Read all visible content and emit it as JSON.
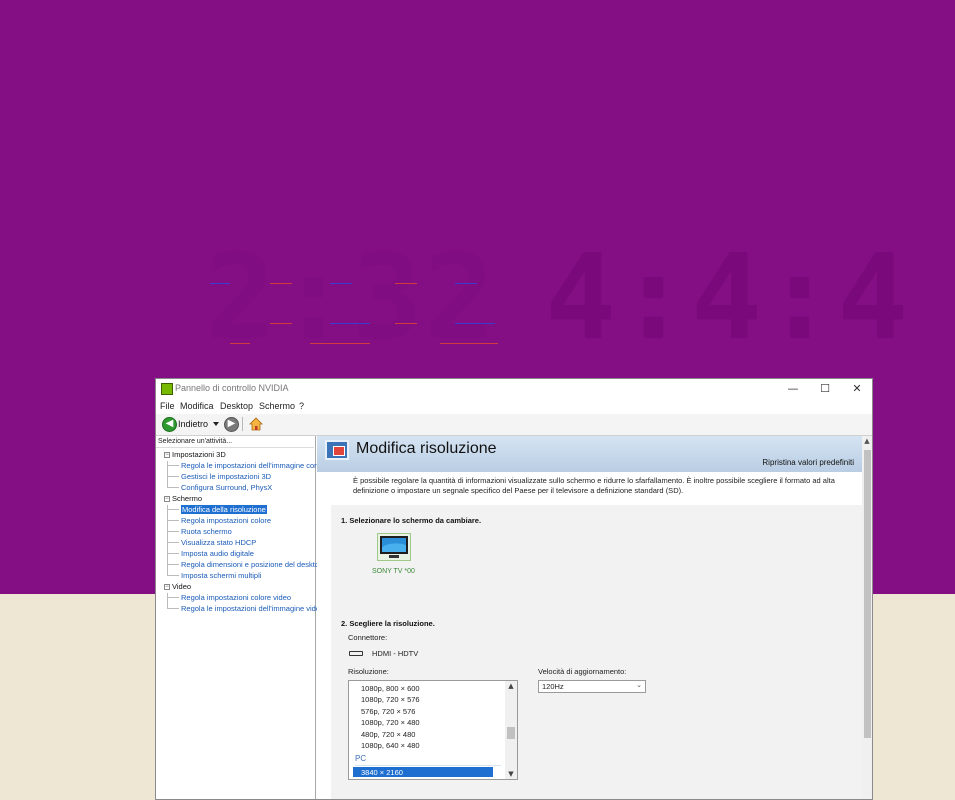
{
  "wallpaper": {
    "clock_left": "2:32",
    "clock_right": "4:4:4",
    "bg_color": "#840e84"
  },
  "window": {
    "title": "Pannello di controllo NVIDIA",
    "controls": {
      "minimize": "—",
      "maximize": "☐",
      "close": "✕"
    }
  },
  "menu": {
    "items": [
      "File",
      "Modifica",
      "Desktop",
      "Schermo",
      "?"
    ]
  },
  "toolbar": {
    "back_label": "Indietro",
    "back_icon": "back-arrow-icon",
    "forward_icon": "forward-arrow-icon",
    "home_icon": "home-icon"
  },
  "left_pane": {
    "header": "Selezionare un'attività...",
    "groups": [
      {
        "label": "Impostazioni 3D",
        "items": [
          "Regola le impostazioni dell'immagine con",
          "Gestisci le impostazioni 3D",
          "Configura Surround, PhysX"
        ]
      },
      {
        "label": "Schermo",
        "items": [
          "Modifica della risoluzione",
          "Regola impostazioni colore",
          "Ruota schermo",
          "Visualizza stato HDCP",
          "Imposta audio digitale",
          "Regola dimensioni e posizione del desktop",
          "Imposta schermi multipli"
        ]
      },
      {
        "label": "Video",
        "items": [
          "Regola impostazioni colore video",
          "Regola le impostazioni dell'immagine vide"
        ]
      }
    ],
    "selected": "Modifica della risoluzione"
  },
  "right_pane": {
    "title": "Modifica risoluzione",
    "restore_label": "Ripristina valori predefiniti",
    "description": "È possibile regolare la quantità di informazioni visualizzate sullo schermo e ridurre lo sfarfallamento. È inoltre possibile scegliere il formato ad alta definizione o impostare un segnale specifico del Paese per il televisore a definizione standard (SD).",
    "step1_title": "1. Selezionare lo schermo da cambiare.",
    "display_label": "SONY TV  *00",
    "step2_title": "2. Scegliere la risoluzione.",
    "connector_label": "Connettore:",
    "connector_value": "HDMI - HDTV",
    "resolution_label": "Risoluzione:",
    "resolution_items": [
      "1080p, 800 × 600",
      "1080p, 720 × 576",
      "576p, 720 × 576",
      "1080p, 720 × 480",
      "480p, 720 × 480",
      "1080p, 640 × 480"
    ],
    "resolution_category": "PC",
    "resolution_selected": "3840 × 2160",
    "refresh_label": "Velocità di aggiornamento:",
    "refresh_value": "120Hz"
  }
}
